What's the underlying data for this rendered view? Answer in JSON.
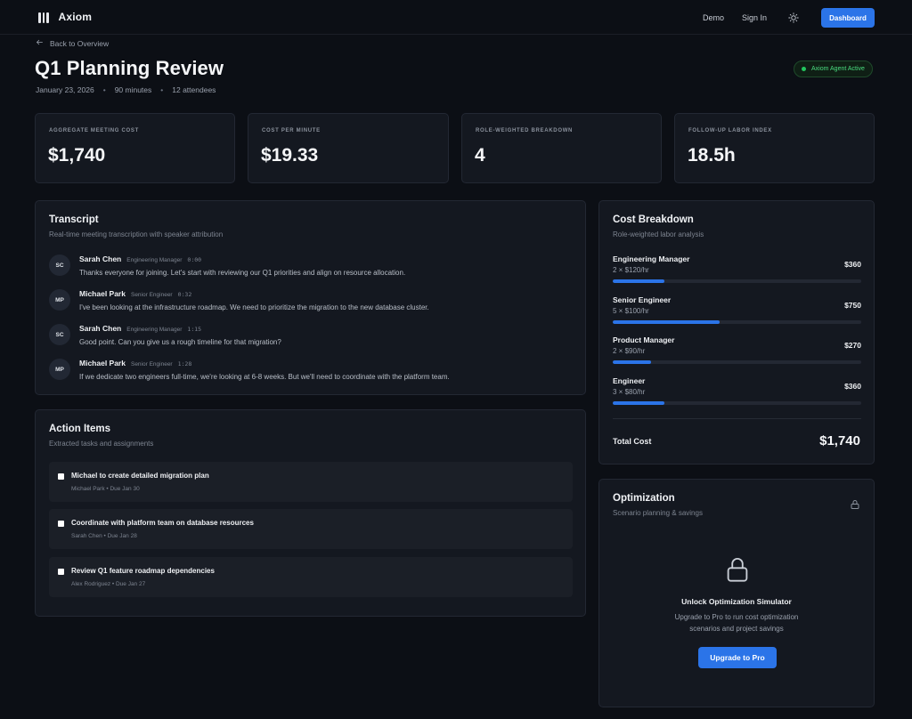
{
  "app": {
    "name": "Axiom"
  },
  "nav": {
    "demo": "Demo",
    "sign_in": "Sign In",
    "dashboard": "Dashboard"
  },
  "header": {
    "back_label": "Back to Overview",
    "title": "Q1 Planning Review",
    "date": "January 23, 2026",
    "duration": "90 minutes",
    "attendees": "12 attendees",
    "agent_status": "Axiom Agent Active"
  },
  "stats": [
    {
      "label": "AGGREGATE MEETING COST",
      "value": "$1,740"
    },
    {
      "label": "COST PER MINUTE",
      "value": "$19.33"
    },
    {
      "label": "ROLE-WEIGHTED BREAKDOWN",
      "value": "4"
    },
    {
      "label": "FOLLOW-UP LABOR INDEX",
      "value": "18.5h"
    }
  ],
  "transcript": {
    "title": "Transcript",
    "subtitle": "Real-time meeting transcription with speaker attribution",
    "entries": [
      {
        "initials": "SC",
        "name": "Sarah Chen",
        "role": "Engineering Manager",
        "time": "0:00",
        "text": "Thanks everyone for joining. Let's start with reviewing our Q1 priorities and align on resource allocation."
      },
      {
        "initials": "MP",
        "name": "Michael Park",
        "role": "Senior Engineer",
        "time": "0:32",
        "text": "I've been looking at the infrastructure roadmap. We need to prioritize the migration to the new database cluster."
      },
      {
        "initials": "SC",
        "name": "Sarah Chen",
        "role": "Engineering Manager",
        "time": "1:15",
        "text": "Good point. Can you give us a rough timeline for that migration?"
      },
      {
        "initials": "MP",
        "name": "Michael Park",
        "role": "Senior Engineer",
        "time": "1:28",
        "text": "If we dedicate two engineers full-time, we're looking at 6-8 weeks. But we'll need to coordinate with the platform team."
      }
    ]
  },
  "actions": {
    "title": "Action Items",
    "subtitle": "Extracted tasks and assignments",
    "items": [
      {
        "title": "Michael to create detailed migration plan",
        "meta": "Michael Park • Due Jan 30"
      },
      {
        "title": "Coordinate with platform team on database resources",
        "meta": "Sarah Chen • Due Jan 28"
      },
      {
        "title": "Review Q1 feature roadmap dependencies",
        "meta": "Alex Rodriguez • Due Jan 27"
      }
    ]
  },
  "cost_breakdown": {
    "title": "Cost Breakdown",
    "subtitle": "Role-weighted labor analysis",
    "rows": [
      {
        "role": "Engineering Manager",
        "rate": "2 × $120/hr",
        "amount": "$360",
        "share": 0.207
      },
      {
        "role": "Senior Engineer",
        "rate": "5 × $100/hr",
        "amount": "$750",
        "share": 0.431
      },
      {
        "role": "Product Manager",
        "rate": "2 × $90/hr",
        "amount": "$270",
        "share": 0.155
      },
      {
        "role": "Engineer",
        "rate": "3 × $80/hr",
        "amount": "$360",
        "share": 0.207
      }
    ],
    "total_label": "Total Cost",
    "total_value": "$1,740"
  },
  "optimization": {
    "title": "Optimization",
    "subtitle": "Scenario planning & savings",
    "heading": "Unlock Optimization Simulator",
    "desc_line1": "Upgrade to Pro to run cost optimization",
    "desc_line2": "scenarios and project savings",
    "button": "Upgrade to Pro"
  },
  "colors": {
    "accent": "#2b74e8",
    "success": "#22c55e",
    "background": "#0c0f15",
    "card": "#141820"
  },
  "icons": [
    "axiom-logo-icon",
    "sun-icon",
    "arrow-left-icon",
    "lock-icon"
  ]
}
